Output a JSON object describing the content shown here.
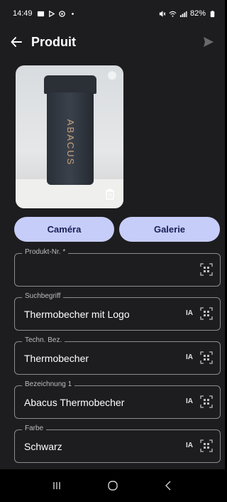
{
  "status": {
    "time": "14:49",
    "battery": "82%"
  },
  "appbar": {
    "title": "Produit"
  },
  "actions": {
    "camera_label": "Caméra",
    "gallery_label": "Galerie"
  },
  "photo": {
    "logo_text": "ABACUS"
  },
  "fields": [
    {
      "label": "Produkt-Nr. *",
      "value": "",
      "ia": ""
    },
    {
      "label": "Suchbegriff",
      "value": "Thermobecher mit Logo",
      "ia": "IA"
    },
    {
      "label": "Techn. Bez.",
      "value": "Thermobecher",
      "ia": "IA"
    },
    {
      "label": "Bezeichnung 1",
      "value": "Abacus Thermobecher",
      "ia": "IA"
    },
    {
      "label": "Farbe",
      "value": "Schwarz",
      "ia": "IA"
    }
  ],
  "colors": {
    "background": "#1d1d1f",
    "button_bg": "#c7cdf9",
    "button_text": "#1a1f57",
    "field_border": "#8b8b90"
  }
}
